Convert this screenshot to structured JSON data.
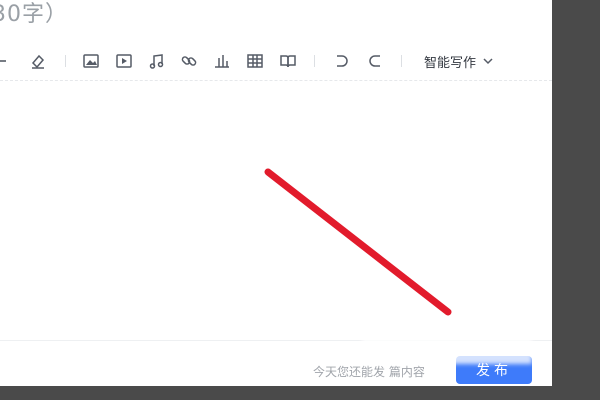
{
  "title_hint": "30字）",
  "toolbar": {
    "icons": [
      "divider-line-icon",
      "eraser-icon",
      "image-icon",
      "video-icon",
      "music-icon",
      "link-icon",
      "chart-icon",
      "table-icon",
      "book-icon",
      "undo-icon",
      "redo-icon"
    ],
    "smart_writing_label": "智能写作"
  },
  "footer": {
    "hint_text": "今天您还能发    篇内容",
    "publish_label": "发布"
  },
  "colors": {
    "accent": "#3e7bfa",
    "arrow": "#e21b2c",
    "icon": "#555b66",
    "background_dark": "#4a4a4a"
  }
}
